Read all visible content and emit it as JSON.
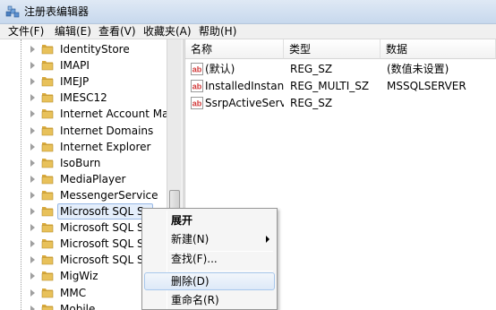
{
  "window": {
    "title": "注册表编辑器"
  },
  "menu": [
    {
      "label": "文件(F)"
    },
    {
      "label": "编辑(E)"
    },
    {
      "label": "查看(V)"
    },
    {
      "label": "收藏夹(A)"
    },
    {
      "label": "帮助(H)"
    }
  ],
  "tree": {
    "items": [
      {
        "label": "IdentityStore"
      },
      {
        "label": "IMAPI"
      },
      {
        "label": "IMEJP"
      },
      {
        "label": "IMESC12"
      },
      {
        "label": "Internet Account Mana"
      },
      {
        "label": "Internet Domains"
      },
      {
        "label": "Internet Explorer"
      },
      {
        "label": "IsoBurn"
      },
      {
        "label": "MediaPlayer"
      },
      {
        "label": "MessengerService"
      },
      {
        "label": "Microsoft SQL Se",
        "selected": true
      },
      {
        "label": "Microsoft SQL Se"
      },
      {
        "label": "Microsoft SQL Se"
      },
      {
        "label": "Microsoft SQL Se"
      },
      {
        "label": "MigWiz"
      },
      {
        "label": "MMC"
      },
      {
        "label": "Mobile"
      }
    ]
  },
  "values": {
    "headers": {
      "name": "名称",
      "type": "类型",
      "data": "数据"
    },
    "rows": [
      {
        "name": "(默认)",
        "type": "REG_SZ",
        "data": "(数值未设置)"
      },
      {
        "name": "InstalledInstan...",
        "type": "REG_MULTI_SZ",
        "data": "MSSQLSERVER"
      },
      {
        "name": "SsrpActiveServ...",
        "type": "REG_SZ",
        "data": ""
      }
    ]
  },
  "context_menu": {
    "items": [
      {
        "label": "展开",
        "bold": true
      },
      {
        "label": "新建(N)",
        "submenu": true
      },
      {
        "label": "查找(F)..."
      },
      {
        "label": "删除(D)",
        "highlighted": true
      },
      {
        "label": "重命名(R)"
      }
    ]
  },
  "icons": {
    "app": "registry-editor-icon",
    "folder": "folder-icon",
    "value": "string-value-icon"
  },
  "colors": {
    "selection": "#e4eefb",
    "selection_border": "#98b9e6",
    "folder": "#e8c15a",
    "value_icon": "#d23a3a"
  }
}
